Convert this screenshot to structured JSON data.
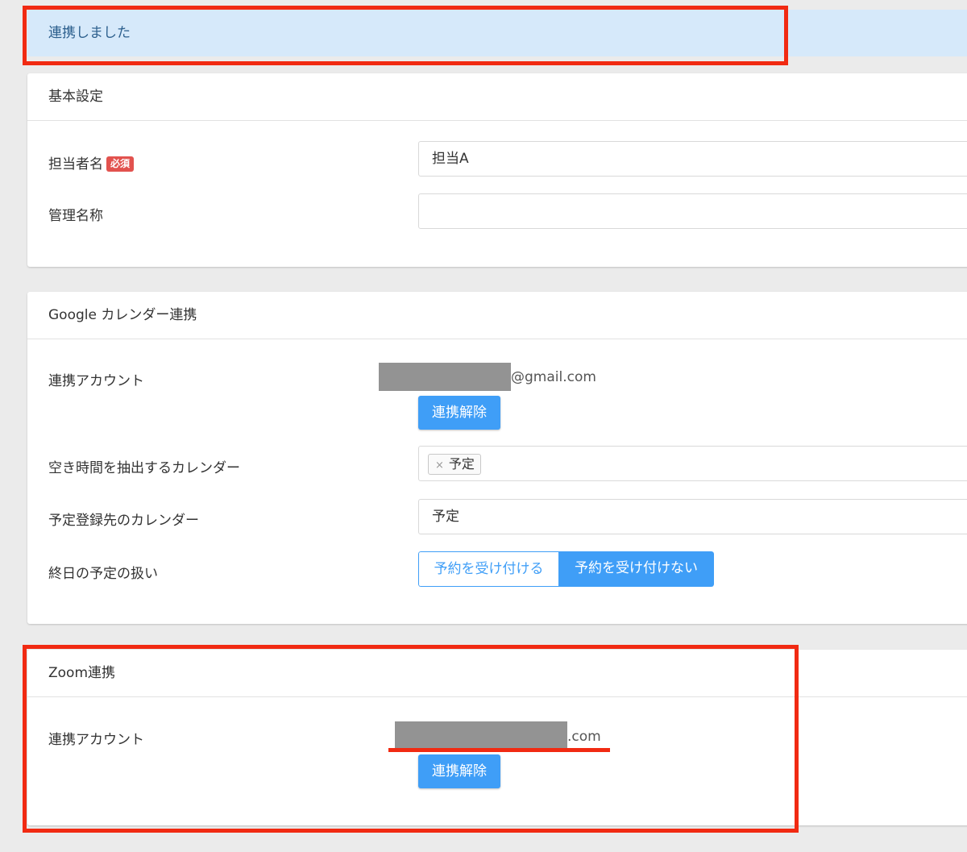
{
  "alert": {
    "message": "連携しました"
  },
  "basic": {
    "title": "基本設定",
    "person_label": "担当者名",
    "required_badge": "必須",
    "person_value": "担当A",
    "admin_label": "管理名称",
    "admin_value": ""
  },
  "google": {
    "title": "Google カレンダー連携",
    "account_label": "連携アカウント",
    "account_suffix": "@gmail.com",
    "unlink_label": "連携解除",
    "free_cal_label": "空き時間を抽出するカレンダー",
    "free_cal_tag": "予定",
    "free_cal_tag_remove": "×",
    "register_cal_label": "予定登録先のカレンダー",
    "register_cal_value": "予定",
    "allday_label": "終日の予定の扱い",
    "allday_options": [
      "予約を受け付ける",
      "予約を受け付けない"
    ],
    "allday_selected": "予約を受け付けない"
  },
  "zoom": {
    "title": "Zoom連携",
    "account_label": "連携アカウント",
    "account_suffix": ".com",
    "unlink_label": "連携解除"
  },
  "colors": {
    "accent": "#3f9ef7",
    "alert_bg": "#d6e9fa",
    "badge": "#e2524e",
    "annotation": "#f12a12"
  }
}
